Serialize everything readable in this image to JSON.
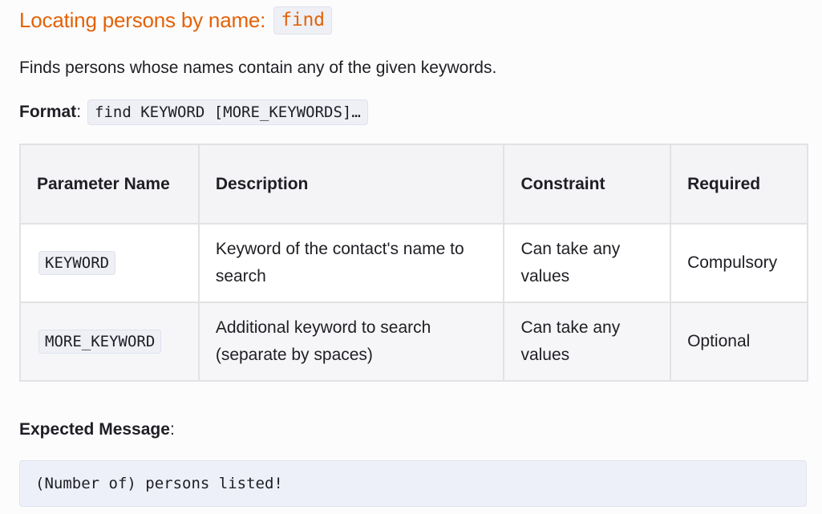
{
  "heading": {
    "text": "Locating persons by name:",
    "command": "find"
  },
  "description": "Finds persons whose names contain any of the given keywords.",
  "format": {
    "label": "Format",
    "separator": ":",
    "command": "find KEYWORD [MORE_KEYWORDS]…"
  },
  "table": {
    "headers": [
      "Parameter Name",
      "Description",
      "Constraint",
      "Required"
    ],
    "rows": [
      {
        "parameter": "KEYWORD",
        "description": "Keyword of the contact's name to search",
        "constraint": "Can take any values",
        "required": "Compulsory"
      },
      {
        "parameter": "MORE_KEYWORD",
        "description": "Additional keyword to search (separate by spaces)",
        "constraint": "Can take any values",
        "required": "Optional"
      }
    ]
  },
  "expected": {
    "label": "Expected Message",
    "separator": ":",
    "message": "(Number of) persons listed!"
  },
  "colors": {
    "heading": "#e36209",
    "code_background": "#eef0f6",
    "codeblock_background": "#eef0f9"
  }
}
